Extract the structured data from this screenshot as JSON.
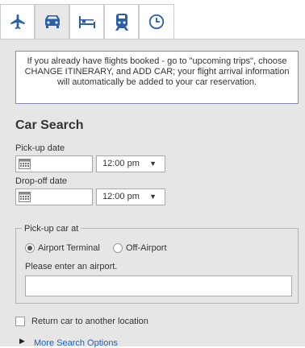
{
  "tabs": [
    {
      "name": "flights",
      "icon": "airplane-icon",
      "active": false
    },
    {
      "name": "cars",
      "icon": "car-icon",
      "active": true
    },
    {
      "name": "hotels",
      "icon": "bed-icon",
      "active": false
    },
    {
      "name": "rail",
      "icon": "train-icon",
      "active": false
    },
    {
      "name": "history",
      "icon": "clock-icon",
      "active": false
    }
  ],
  "colors": {
    "accent": "#1a63c6",
    "panel_bg": "#e6e6e6",
    "info_border": "#8a8ab0"
  },
  "info_message": "If you already have flights booked - go to \"upcoming trips\", choose CHANGE ITINERARY, and ADD CAR; your flight arrival information will automatically be added to your car reservation.",
  "search": {
    "title": "Car Search",
    "pickup_date_label": "Pick-up date",
    "pickup_time": "12:00 pm",
    "dropoff_date_label": "Drop-off date",
    "dropoff_time": "12:00 pm",
    "pickup_legend": "Pick-up car at",
    "option_airport": "Airport Terminal",
    "option_off_airport": "Off-Airport",
    "selected_option": "Airport Terminal",
    "airport_prompt": "Please enter an airport.",
    "airport_value": "",
    "return_other_label": "Return car to another location",
    "return_other_checked": false,
    "more_options_label": "More Search Options"
  }
}
